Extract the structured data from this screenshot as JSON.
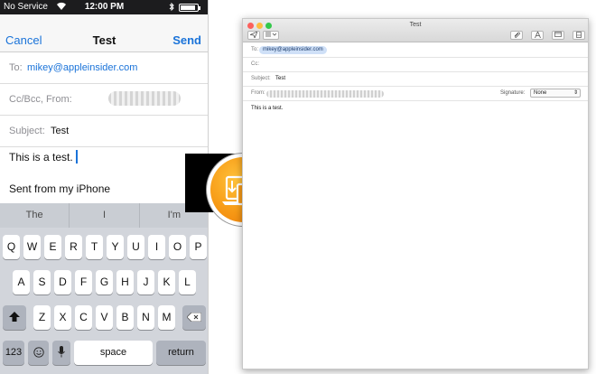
{
  "phone": {
    "status": {
      "carrier": "No Service",
      "time": "12:00 PM"
    },
    "nav": {
      "cancel": "Cancel",
      "title": "Test",
      "send": "Send"
    },
    "to": {
      "label": "To:",
      "value": "mikey@appleinsider.com"
    },
    "cc": {
      "label": "Cc/Bcc, From:"
    },
    "subject": {
      "label": "Subject:",
      "value": "Test"
    },
    "body": "This is a test.",
    "signature": "Sent from my iPhone",
    "suggestions": [
      "The",
      "I",
      "I'm"
    ],
    "keyboard": {
      "row1": [
        "Q",
        "W",
        "E",
        "R",
        "T",
        "Y",
        "U",
        "I",
        "O",
        "P"
      ],
      "row2": [
        "A",
        "S",
        "D",
        "F",
        "G",
        "H",
        "J",
        "K",
        "L"
      ],
      "row3": [
        "Z",
        "X",
        "C",
        "V",
        "B",
        "N",
        "M"
      ],
      "numbers": "123",
      "space": "space",
      "return": "return"
    }
  },
  "mac": {
    "window_title": "Test",
    "to": {
      "label": "To:",
      "value": "mikey@appleinsider.com"
    },
    "cc": {
      "label": "Cc:"
    },
    "subject": {
      "label": "Subject:",
      "value": "Test"
    },
    "from": {
      "label": "From:",
      "signature_label": "Signature:",
      "signature_value": "None"
    },
    "body": "This is a test."
  },
  "colors": {
    "ios_blue": "#1a73d9",
    "handoff_orange": "#f79a16",
    "mac_chip": "#cfe0f7"
  }
}
